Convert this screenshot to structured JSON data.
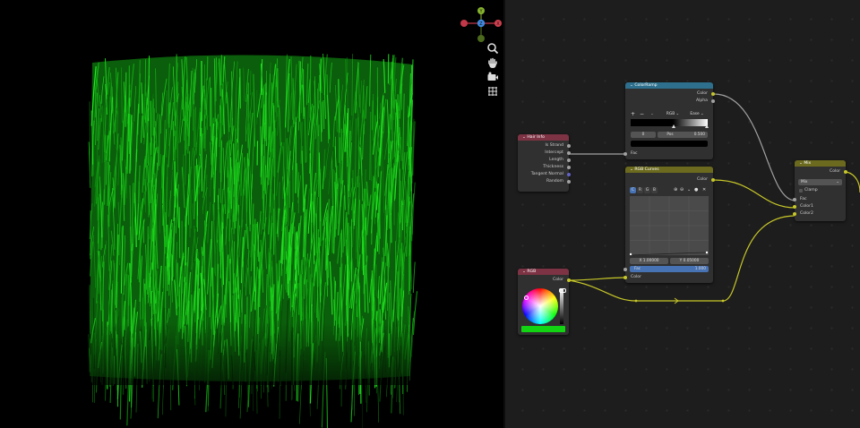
{
  "viewport": {
    "gizmo_axes": {
      "x": "X",
      "y": "Y",
      "z": "Z"
    },
    "tools": [
      "zoom-icon",
      "hand-icon",
      "camera-icon",
      "grid-icon"
    ]
  },
  "nodes": {
    "hair_info": {
      "title": "Hair Info",
      "outputs": [
        "Is Strand",
        "Intercept",
        "Length",
        "Thickness",
        "Tangent Normal",
        "Random"
      ]
    },
    "color_ramp": {
      "title": "ColorRamp",
      "outputs": [
        "Color",
        "Alpha"
      ],
      "controls": {
        "add": "+",
        "remove": "−",
        "mode": "RGB",
        "interpolation": "Ease"
      },
      "index": "0",
      "pos_label": "Pos",
      "pos_value": "0.500",
      "input": "Fac"
    },
    "rgb_curves": {
      "title": "RGB Curves",
      "output": "Color",
      "channels": [
        "C",
        "R",
        "G",
        "B"
      ],
      "x_readout": "X 1.00000",
      "y_readout": "Y 0.05000",
      "fac_label": "Fac",
      "fac_value": "1.000",
      "input": "Color"
    },
    "rgb": {
      "title": "RGB",
      "output": "Color",
      "color": "#12d412"
    },
    "mix": {
      "title": "Mix",
      "output": "Color",
      "blend_mode": "Mix",
      "clamp_label": "Clamp",
      "inputs": [
        "Fac",
        "Color1",
        "Color2"
      ]
    }
  },
  "colors": {
    "grass": "#16c316",
    "header_input": "#7d3344",
    "header_converter": "#2d6f8c",
    "header_color": "#6b6a1e",
    "link_color": "#c7c729",
    "link_float": "#a1a1a1"
  }
}
